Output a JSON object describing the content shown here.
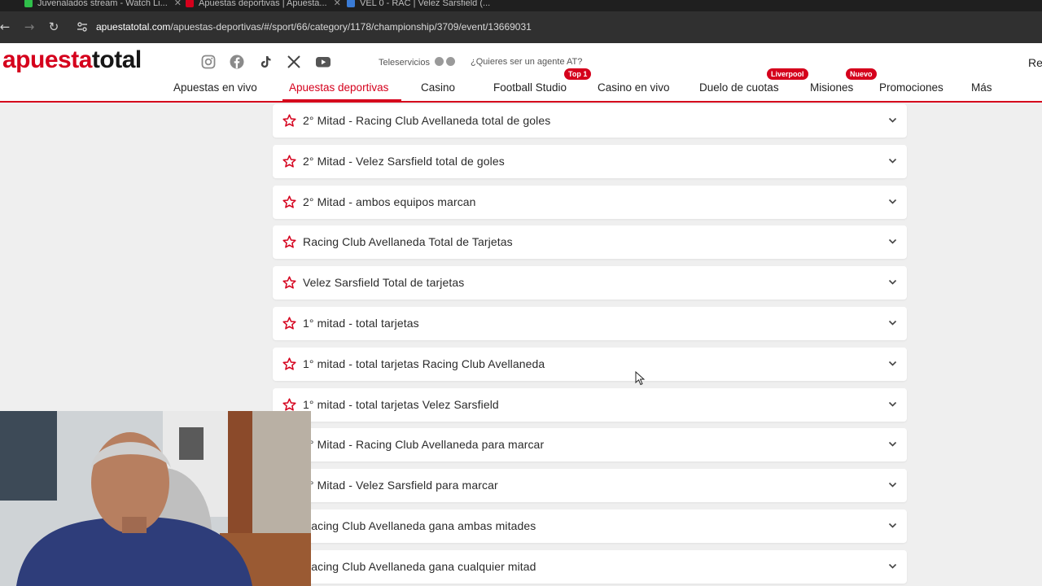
{
  "browser": {
    "tabs": [
      {
        "title": "Juvenalados stream - Watch Li..."
      },
      {
        "title": "Apuestas deportivas | Apuesta..."
      },
      {
        "title": "VEL 0 - RAC | Velez Sarsfield (..."
      }
    ],
    "url_domain": "apuestatotal.com",
    "url_path": "/apuestas-deportivas/#/sport/66/category/1178/championship/3709/event/13669031"
  },
  "header": {
    "logo_part1": "apuesta",
    "logo_part2": "total",
    "social": [
      "instagram-icon",
      "facebook-icon",
      "tiktok-icon",
      "x-icon",
      "youtube-icon"
    ],
    "teleservicios": "Teleservicios",
    "agente": "¿Quieres ser un agente AT?",
    "top_right": "Re",
    "nav": [
      {
        "label": "Apuestas en vivo"
      },
      {
        "label": "Apuestas deportivas",
        "active": true
      },
      {
        "label": "Casino"
      },
      {
        "label": "Football Studio",
        "badge": "Top 1"
      },
      {
        "label": "Casino en vivo"
      },
      {
        "label": "Duelo de cuotas",
        "badge": "Liverpool"
      },
      {
        "label": "Misiones",
        "badge": "Nuevo"
      },
      {
        "label": "Promociones"
      },
      {
        "label": "Más"
      }
    ],
    "accent_color": "#d5001c"
  },
  "markets": [
    "2° Mitad - Racing Club Avellaneda total de goles",
    "2° Mitad - Velez Sarsfield total de goles",
    "2° Mitad - ambos equipos marcan",
    "Racing Club Avellaneda Total de Tarjetas",
    "Velez Sarsfield Total de tarjetas",
    "1° mitad - total tarjetas",
    "1° mitad - total tarjetas Racing Club Avellaneda",
    "1° mitad - total tarjetas Velez Sarsfield",
    "1° Mitad - Racing Club Avellaneda para marcar",
    "1° Mitad - Velez Sarsfield para marcar",
    "Racing Club Avellaneda gana ambas mitades",
    "Racing Club Avellaneda gana cualquier mitad"
  ]
}
